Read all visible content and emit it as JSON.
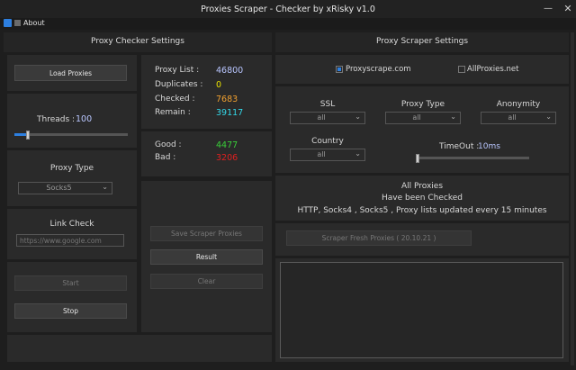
{
  "window": {
    "title": "Proxies Scraper - Checker by xRisky v1.0",
    "minimize": "—",
    "close": "✕"
  },
  "menu": {
    "about": "About"
  },
  "checker": {
    "header": "Proxy Checker Settings",
    "load_button": "Load Proxies",
    "threads_label": "Threads :",
    "threads_value": "100",
    "threads_fraction": 0.12,
    "proxy_type_label": "Proxy Type",
    "proxy_type_value": "Socks5",
    "link_check_label": "Link Check",
    "link_check_placeholder": "https://www.google.com",
    "start_button": "Start",
    "stop_button": "Stop"
  },
  "stats": {
    "proxy_list_label": "Proxy List :",
    "proxy_list_value": "46800",
    "duplicates_label": "Duplicates :",
    "duplicates_value": "0",
    "checked_label": "Checked :",
    "checked_value": "7683",
    "remain_label": "Remain :",
    "remain_value": "39117",
    "good_label": "Good :",
    "good_value": "4477",
    "bad_label": "Bad :",
    "bad_value": "3206"
  },
  "actions": {
    "save_button": "Save Scraper Proxies",
    "result_button": "Result",
    "clear_button": "Clear"
  },
  "scraper": {
    "header": "Proxy Scraper Settings",
    "source1": "Proxyscrape.com",
    "source2": "AllProxies.net",
    "ssl_label": "SSL",
    "ssl_value": "all",
    "proxy_type_label": "Proxy Type",
    "proxy_type_value": "all",
    "anonymity_label": "Anonymity",
    "anonymity_value": "all",
    "country_label": "Country",
    "country_value": "all",
    "timeout_label": "TimeOut :",
    "timeout_value": "10ms",
    "timeout_fraction": 0.0,
    "info_line1": "All Proxies",
    "info_line2": "Have been Checked",
    "info_line3": "HTTP, Socks4 , Socks5 , Proxy lists updated every 15 minutes",
    "scrape_button": "Scraper Fresh Proxies ( 20.10.21 )"
  },
  "colors": {
    "accent": "#2d7fe0",
    "proxy_list": "#b9c6ff",
    "duplicates": "#e8e000",
    "checked": "#f0a030",
    "remain": "#33d7e8",
    "good": "#39d039",
    "bad": "#e02020"
  }
}
